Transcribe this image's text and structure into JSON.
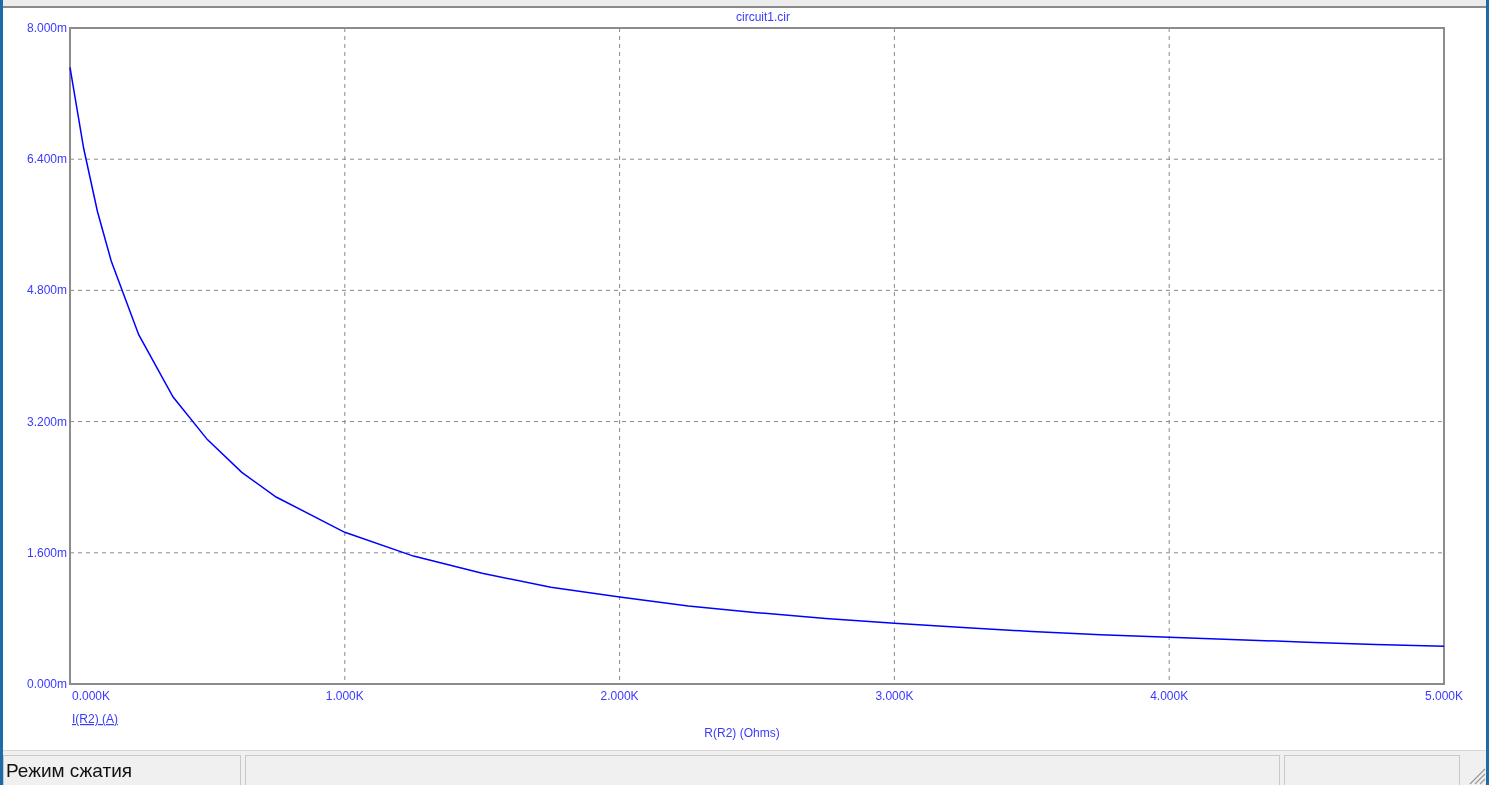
{
  "plot": {
    "title": "circuit1.cir",
    "chart_data": {
      "type": "line",
      "xlabel": "R(R2) (Ohms)",
      "grid": true,
      "x": [
        0,
        50,
        100,
        150,
        250,
        375,
        500,
        625,
        750,
        1000,
        1250,
        1500,
        1750,
        2000,
        2250,
        2500,
        2750,
        3000,
        3250,
        3500,
        3750,
        4000,
        4250,
        4500,
        4750,
        5000
      ],
      "series": [
        {
          "name": "I(R2) (A)",
          "color": "#0000ff",
          "values": [
            7.52,
            6.53,
            5.76,
            5.16,
            4.26,
            3.5,
            2.98,
            2.58,
            2.28,
            1.85,
            1.56,
            1.35,
            1.18,
            1.06,
            0.95,
            0.87,
            0.8,
            0.74,
            0.69,
            0.64,
            0.6,
            0.57,
            0.54,
            0.51,
            0.48,
            0.46
          ]
        }
      ],
      "xlim": [
        0,
        5000
      ],
      "ylim": [
        0,
        8
      ],
      "xticks": [
        {
          "value": 0,
          "label": "0.000K"
        },
        {
          "value": 1000,
          "label": "1.000K"
        },
        {
          "value": 2000,
          "label": "2.000K"
        },
        {
          "value": 3000,
          "label": "3.000K"
        },
        {
          "value": 4000,
          "label": "4.000K"
        },
        {
          "value": 5000,
          "label": "5.000K"
        }
      ],
      "yticks": [
        {
          "value": 0,
          "label": "0.000m"
        },
        {
          "value": 1.6,
          "label": "1.600m"
        },
        {
          "value": 3.2,
          "label": "3.200m"
        },
        {
          "value": 4.8,
          "label": "4.800m"
        },
        {
          "value": 6.4,
          "label": "6.400m"
        },
        {
          "value": 8,
          "label": "8.000m"
        }
      ]
    }
  },
  "status_bar": {
    "panes": [
      "Режим сжатия"
    ]
  }
}
